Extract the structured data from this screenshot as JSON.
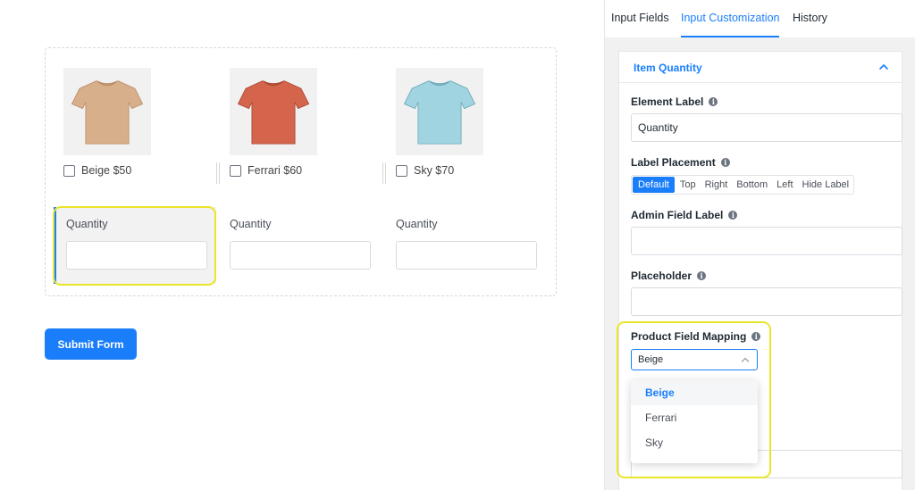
{
  "form": {
    "products": [
      {
        "label": "Beige $50",
        "color": "#d8af8b"
      },
      {
        "label": "Ferrari $60",
        "color": "#d4654c"
      },
      {
        "label": "Sky $70",
        "color": "#9fd4e0"
      }
    ],
    "quantity_fields": [
      {
        "label": "Quantity"
      },
      {
        "label": "Quantity"
      },
      {
        "label": "Quantity"
      }
    ],
    "submit_label": "Submit Form"
  },
  "panel": {
    "tabs": [
      {
        "label": "Input Fields"
      },
      {
        "label": "Input Customization"
      },
      {
        "label": "History"
      }
    ],
    "section_title": "Item Quantity",
    "element_label": {
      "label": "Element Label",
      "value": "Quantity"
    },
    "label_placement": {
      "label": "Label Placement",
      "options": [
        "Default",
        "Top",
        "Right",
        "Bottom",
        "Left",
        "Hide Label"
      ],
      "selected": "Default"
    },
    "admin_field_label": {
      "label": "Admin Field Label",
      "value": ""
    },
    "placeholder": {
      "label": "Placeholder",
      "value": ""
    },
    "product_field_mapping": {
      "label": "Product Field Mapping",
      "selected": "Beige",
      "options": [
        "Beige",
        "Ferrari",
        "Sky"
      ]
    }
  },
  "colors": {
    "accent": "#1a7efb",
    "highlight": "#e9e62a"
  }
}
